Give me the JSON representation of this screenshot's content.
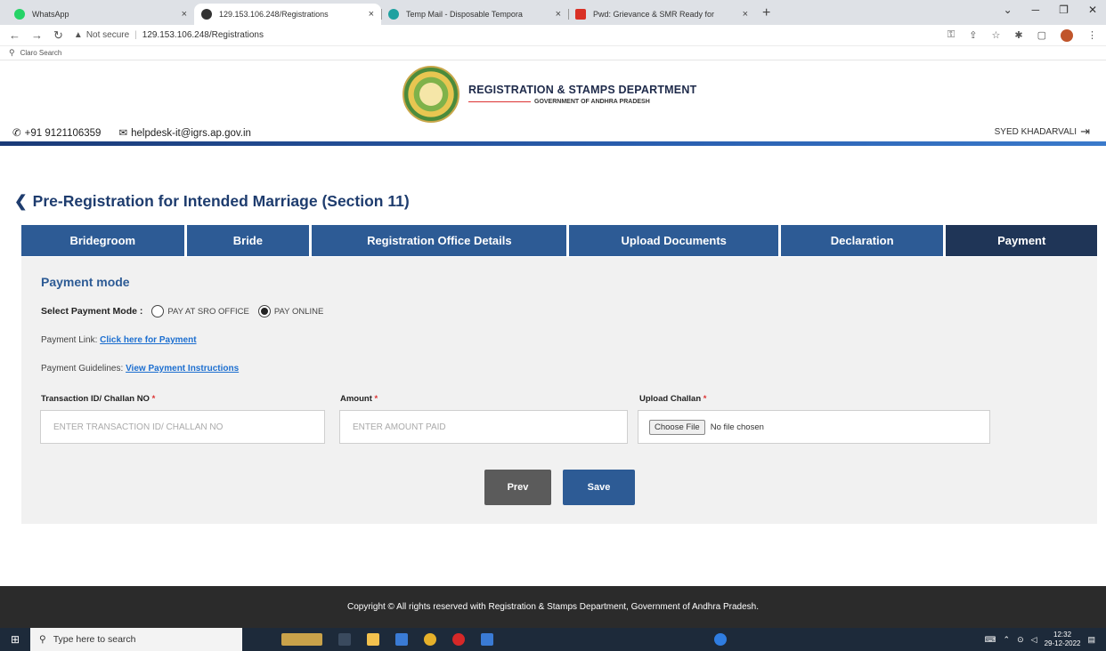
{
  "browser": {
    "tabs": [
      {
        "title": "WhatsApp",
        "color": "#25d366",
        "active": false
      },
      {
        "title": "129.153.106.248/Registrations",
        "color": "#333333",
        "active": true
      },
      {
        "title": "Temp Mail - Disposable Tempora",
        "color": "#1ea1a0",
        "active": false
      },
      {
        "title": "Pwd: Grievance & SMR Ready for",
        "color": "#d93025",
        "active": false
      }
    ],
    "new_tab": "+",
    "not_secure": "Not secure",
    "url": "129.153.106.248/Registrations",
    "bookmark": "Claro Search"
  },
  "header": {
    "dept_title": "REGISTRATION & STAMPS DEPARTMENT",
    "dept_subtitle": "GOVERNMENT OF ANDHRA PRADESH",
    "phone": "+91 9121106359",
    "email": "helpdesk-it@igrs.ap.gov.in",
    "user": "SYED KHADARVALI"
  },
  "page": {
    "title": "Pre-Registration for Intended Marriage (Section 11)",
    "tabs": [
      "Bridegroom",
      "Bride",
      "Registration Office Details",
      "Upload Documents",
      "Declaration",
      "Payment"
    ],
    "active_tab": "Payment"
  },
  "payment": {
    "section_title": "Payment mode",
    "mode_label": "Select Payment Mode :",
    "options": [
      "PAY AT SRO OFFICE",
      "PAY ONLINE"
    ],
    "selected": "PAY ONLINE",
    "link_label": "Payment Link:",
    "link_text": "Click here for Payment",
    "guidelines_label": "Payment Guidelines:",
    "guidelines_text": "View Payment Instructions",
    "txn_label": "Transaction ID/ Challan NO",
    "txn_placeholder": "ENTER TRANSACTION ID/ CHALLAN NO",
    "amount_label": "Amount",
    "amount_placeholder": "ENTER AMOUNT PAID",
    "upload_label": "Upload Challan",
    "choose_file": "Choose File",
    "no_file": "No file chosen",
    "required_mark": "*",
    "prev_label": "Prev",
    "save_label": "Save"
  },
  "footer": {
    "text": "Copyright © All rights reserved with Registration & Stamps Department, Government of Andhra Pradesh."
  },
  "taskbar": {
    "search_placeholder": "Type here to search",
    "time": "12:32",
    "date": "29-12-2022"
  }
}
